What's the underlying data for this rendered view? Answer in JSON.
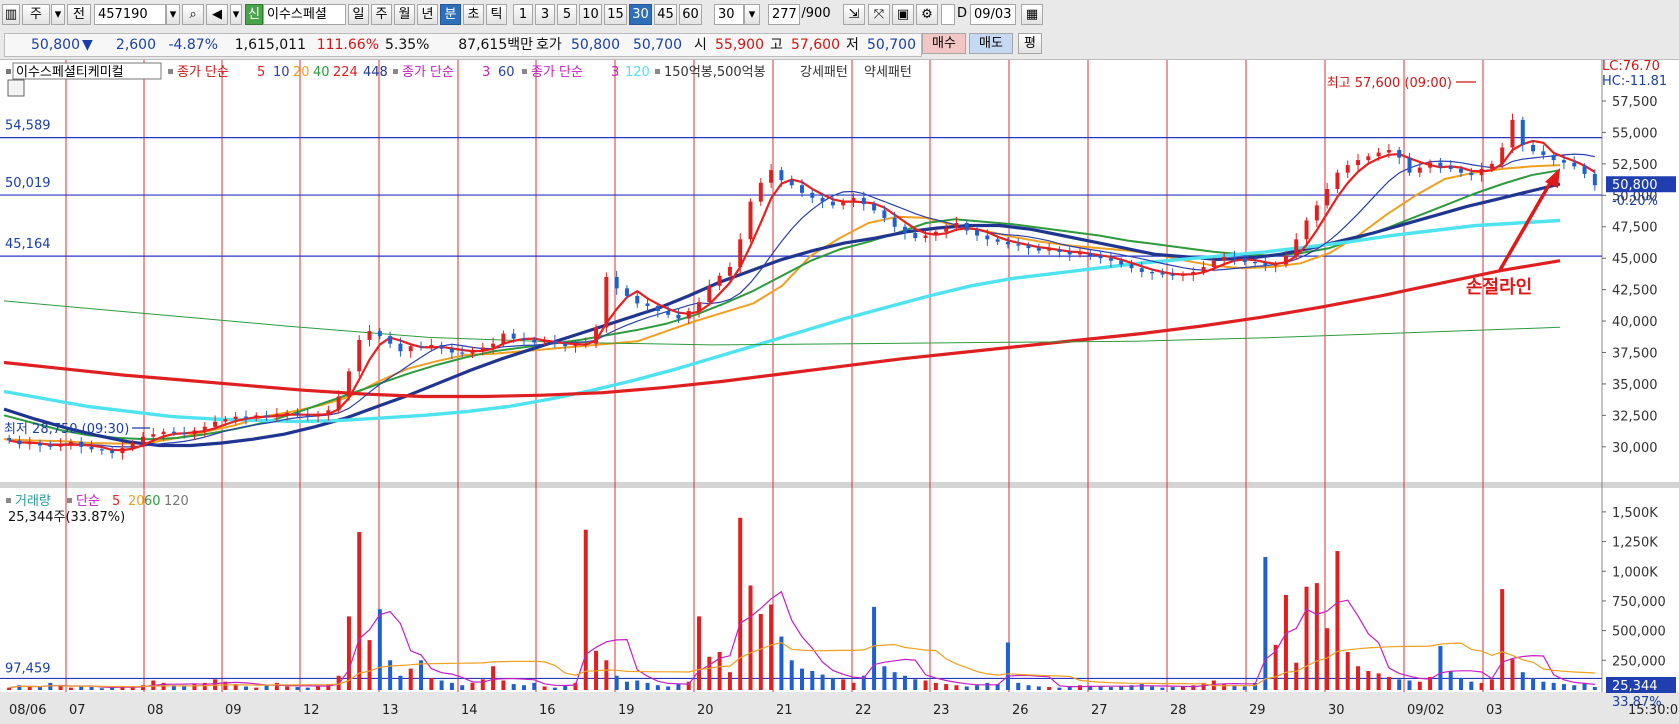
{
  "toolbar": {
    "period_type": "주",
    "prev_label": "전",
    "stock_code": "457190",
    "new_badge": "신",
    "stock_name_short": "이수스페셜",
    "period_buttons": [
      "일",
      "주",
      "월",
      "년",
      "분",
      "초",
      "틱"
    ],
    "active_period": "분",
    "interval_buttons": [
      "1",
      "3",
      "5",
      "10",
      "15",
      "30",
      "45",
      "60"
    ],
    "active_interval": "30",
    "interval_select": "30",
    "count_value": "277",
    "count_total": "/900",
    "d_label": "D",
    "date_value": "09/03"
  },
  "quote": {
    "price": "50,800",
    "direction_arrow": "▼",
    "change": "2,600",
    "change_pct": "-4.87%",
    "volume": "1,615,011",
    "volume_ratio": "111.66%",
    "turnover": "5.35%",
    "amount": "87,615백만",
    "hoga_label": "호가",
    "ask": "50,800",
    "bid": "50,700",
    "open_label": "시",
    "open": "55,900",
    "high_label": "고",
    "high": "57,600",
    "low_label": "저",
    "low": "50,700",
    "buy_label": "매수",
    "sell_label": "매도",
    "eval_label": "평"
  },
  "price_legend": {
    "stock_name": "이수스페셜티케미컬",
    "ma_title": "종가 단순",
    "ma_periods": [
      "5",
      "10",
      "20",
      "40",
      "224",
      "448"
    ],
    "ma_title2": "종가 단순",
    "ma_periods2": [
      "3",
      "60"
    ],
    "ma_title3": "종가 단순",
    "ma_periods3": [
      "3",
      "120"
    ],
    "pattern_label": "150억봉,500억봉",
    "strong_pattern": "강세패턴",
    "weak_pattern": "약세패턴"
  },
  "volume_legend": {
    "title": "거래량",
    "ma_title": "단순",
    "ma_periods": [
      "5",
      "20",
      "60",
      "120"
    ],
    "current": "25,344주(33.87%)"
  },
  "annotations": {
    "high_marker": "최고 57,600 (09:00)",
    "low_marker": "최저 28,750 (09:30)",
    "stop_loss": "손절라인",
    "lc": "LC:76.70",
    "hc": "HC:-11.81",
    "price_tag": "50,800",
    "price_tag_pct": "-0.20%",
    "volume_tag": "25,344",
    "volume_tag_pct": "33.87%",
    "left_levels": [
      "54,589",
      "50,019",
      "45,164",
      "97,459"
    ],
    "time_label": "15:30:00"
  },
  "colors": {
    "up": "#e02020",
    "down": "#1f5fd0",
    "ma5": "#e82020",
    "ma10": "#2a3fb0",
    "ma20": "#f0a020",
    "ma40": "#2e9a3e",
    "ma224": "#e02020",
    "ma448": "#1f3590",
    "ma120": "#4fe3f0"
  },
  "chart_data": {
    "type": "candlestick",
    "y_axis_ticks": [
      "57,500",
      "55,000",
      "52,500",
      "50,000",
      "47,500",
      "45,000",
      "42,500",
      "40,000",
      "37,500",
      "35,000",
      "32,500",
      "30,000"
    ],
    "ylim": [
      27500,
      59000
    ],
    "x_labels": [
      "08/06",
      "07",
      "08",
      "09",
      "12",
      "13",
      "14",
      "16",
      "19",
      "20",
      "21",
      "22",
      "23",
      "26",
      "27",
      "28",
      "29",
      "30",
      "09/02",
      "03"
    ],
    "horizontal_levels": [
      54589,
      50019,
      45164
    ],
    "close_path": [
      30500,
      30200,
      30300,
      30100,
      30000,
      30200,
      30400,
      30000,
      29800,
      29700,
      29500,
      29900,
      30300,
      30800,
      31000,
      31200,
      31100,
      31000,
      31300,
      31600,
      32000,
      32200,
      32400,
      32300,
      32500,
      32400,
      32600,
      32700,
      32500,
      32400,
      32600,
      32900,
      34000,
      36000,
      38500,
      39200,
      38800,
      38200,
      37600,
      38000,
      37900,
      38100,
      37800,
      37500,
      37400,
      37700,
      37900,
      38200,
      39000,
      38600,
      38500,
      38300,
      38400,
      38200,
      38000,
      38100,
      38200,
      39500,
      43500,
      42600,
      42000,
      41400,
      41200,
      40800,
      40500,
      40200,
      40800,
      41500,
      42800,
      43600,
      44300,
      46500,
      49500,
      51000,
      52000,
      51200,
      50800,
      50200,
      49800,
      49500,
      49200,
      49500,
      49800,
      49300,
      48800,
      48200,
      47500,
      47000,
      46600,
      46800,
      47100,
      47400,
      47800,
      47200,
      46800,
      46500,
      46300,
      46100,
      46000,
      45800,
      45600,
      45700,
      45500,
      45300,
      45400,
      45200,
      45000,
      44800,
      44500,
      44200,
      43900,
      43800,
      43700,
      43600,
      43700,
      43900,
      44300,
      44800,
      45100,
      45000,
      44700,
      44600,
      44400,
      44500,
      45200,
      46500,
      48000,
      49200,
      50500,
      51800,
      52400,
      52800,
      53100,
      53400,
      53600,
      53000,
      51800,
      52200,
      52600,
      52300,
      52100,
      51800,
      51600,
      52100,
      52500,
      53800,
      56000,
      54000,
      53500,
      53200,
      52800,
      52600,
      52300,
      51700,
      50800
    ],
    "ma_lines": [
      {
        "name": "20",
        "values": [
          30600,
          30500,
          30450,
          30300,
          30250,
          30300,
          30700,
          31200,
          31700,
          32400,
          32800,
          33300,
          34000,
          35200,
          36200,
          36800,
          37300,
          37400,
          37600,
          37800,
          38000,
          38200,
          38400,
          39200,
          40000,
          40700,
          41400,
          42800,
          45200,
          46600,
          47800,
          48300,
          48200,
          47600,
          47200,
          46700,
          46300,
          46000,
          45800,
          45600,
          45300,
          44800,
          44400,
          44200,
          44300,
          44600,
          45400,
          46800,
          48500,
          50000,
          51300,
          51800,
          52100,
          52300,
          52400
        ]
      },
      {
        "name": "40",
        "values": [
          32500,
          31900,
          31300,
          30900,
          30700,
          30600,
          30700,
          31000,
          31400,
          31900,
          32600,
          33400,
          34200,
          35000,
          35800,
          36500,
          37100,
          37600,
          37900,
          38200,
          38500,
          38900,
          39300,
          39800,
          40500,
          41400,
          42400,
          43600,
          44800,
          45700,
          46300,
          47000,
          47800,
          48100,
          47900,
          47700,
          47400,
          47100,
          46800,
          46400,
          46100,
          45800,
          45500,
          45300,
          45200,
          45400,
          45800,
          46600,
          47400,
          48300,
          49200,
          50100,
          50900,
          51600,
          52000
        ]
      },
      {
        "name": "448",
        "values": [
          33000,
          32200,
          31500,
          30900,
          30400,
          30100,
          30100,
          30300,
          30600,
          31000,
          31600,
          32300,
          33200,
          34100,
          35100,
          36100,
          37000,
          37800,
          38600,
          39400,
          40200,
          41000,
          42000,
          43100,
          44000,
          44900,
          45600,
          46200,
          46600,
          47100,
          47400,
          47600,
          47600,
          47300,
          46800,
          46300,
          45800,
          45300,
          45100,
          44900,
          45000,
          45300,
          45800,
          46400,
          47000,
          47700,
          48400,
          49100,
          49700,
          50300,
          50900
        ]
      },
      {
        "name": "120",
        "values": [
          34400,
          33800,
          33200,
          32800,
          32400,
          32200,
          32100,
          32000,
          32100,
          32300,
          32500,
          32800,
          33200,
          33800,
          34500,
          35300,
          36200,
          37200,
          38200,
          39200,
          40200,
          41100,
          42000,
          42800,
          43400,
          43800,
          44200,
          44600,
          44900,
          45200,
          45500,
          45900,
          46300,
          46800,
          47200,
          47600,
          47800,
          48000
        ]
      },
      {
        "name": "224",
        "values": [
          36700,
          36200,
          35700,
          35300,
          34900,
          34500,
          34200,
          34000,
          34000,
          34100,
          34300,
          34700,
          35200,
          35800,
          36400,
          37000,
          37500,
          38000,
          38500,
          39000,
          39600,
          40300,
          41100,
          42000,
          43000,
          44000,
          44800
        ]
      },
      {
        "name": "thin-green",
        "values": [
          41600,
          40600,
          39600,
          38700,
          38300,
          38100,
          38200,
          38300,
          38400,
          38700,
          39100,
          39500
        ]
      }
    ],
    "volume_axis_ticks": [
      "1,500K",
      "1,250K",
      "1,000K",
      "750,000",
      "500,000",
      "250,000"
    ],
    "volume_max": 1600000,
    "volume_level": 97459,
    "volume_path": [
      20000,
      40000,
      30000,
      25000,
      60000,
      35000,
      20000,
      30000,
      25000,
      15000,
      20000,
      30000,
      25000,
      40000,
      80000,
      60000,
      40000,
      30000,
      50000,
      60000,
      90000,
      70000,
      50000,
      30000,
      20000,
      40000,
      60000,
      30000,
      25000,
      20000,
      35000,
      50000,
      120000,
      620000,
      1330000,
      420000,
      680000,
      250000,
      120000,
      180000,
      250000,
      100000,
      80000,
      60000,
      40000,
      60000,
      90000,
      200000,
      80000,
      50000,
      40000,
      60000,
      30000,
      20000,
      40000,
      60000,
      1350000,
      330000,
      250000,
      120000,
      70000,
      80000,
      60000,
      40000,
      30000,
      50000,
      70000,
      620000,
      280000,
      320000,
      150000,
      1450000,
      880000,
      640000,
      720000,
      450000,
      250000,
      180000,
      160000,
      130000,
      100000,
      90000,
      60000,
      120000,
      700000,
      200000,
      150000,
      120000,
      90000,
      80000,
      60000,
      50000,
      40000,
      30000,
      40000,
      60000,
      50000,
      400000,
      60000,
      40000,
      30000,
      25000,
      20000,
      30000,
      40000,
      35000,
      30000,
      25000,
      30000,
      40000,
      50000,
      30000,
      20000,
      25000,
      30000,
      40000,
      60000,
      80000,
      50000,
      40000,
      30000,
      60000,
      1120000,
      380000,
      800000,
      230000,
      870000,
      900000,
      520000,
      1170000,
      320000,
      200000,
      160000,
      140000,
      110000,
      90000,
      80000,
      70000,
      110000,
      370000,
      160000,
      100000,
      70000,
      60000,
      90000,
      850000,
      260000,
      150000,
      100000,
      70000,
      60000,
      50000,
      40000,
      60000,
      25344
    ]
  }
}
